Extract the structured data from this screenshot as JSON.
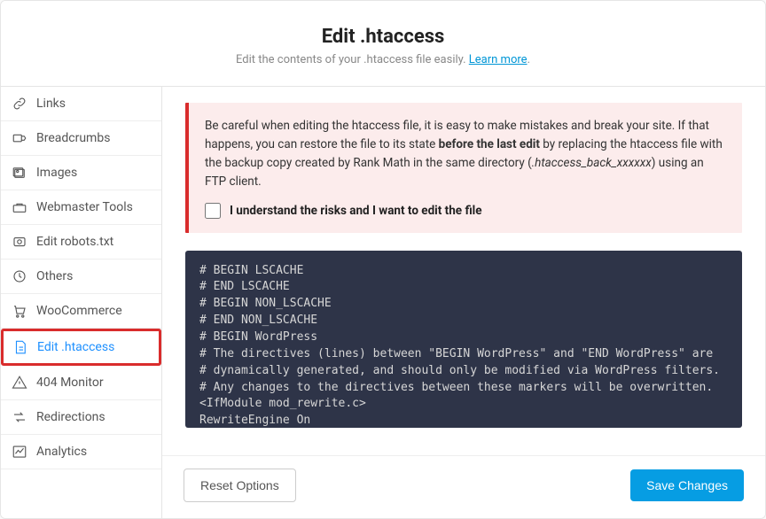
{
  "header": {
    "title": "Edit .htaccess",
    "subtitle_prefix": "Edit the contents of your .htaccess file easily. ",
    "learn_more": "Learn more",
    "subtitle_suffix": "."
  },
  "sidebar": {
    "items": [
      {
        "icon": "link-icon",
        "label": "Links"
      },
      {
        "icon": "breadcrumb-icon",
        "label": "Breadcrumbs"
      },
      {
        "icon": "images-icon",
        "label": "Images"
      },
      {
        "icon": "webmaster-icon",
        "label": "Webmaster Tools"
      },
      {
        "icon": "robots-icon",
        "label": "Edit robots.txt"
      },
      {
        "icon": "others-icon",
        "label": "Others"
      },
      {
        "icon": "cart-icon",
        "label": "WooCommerce"
      },
      {
        "icon": "file-icon",
        "label": "Edit .htaccess"
      },
      {
        "icon": "warning-icon",
        "label": "404 Monitor"
      },
      {
        "icon": "redirections-icon",
        "label": "Redirections"
      },
      {
        "icon": "analytics-icon",
        "label": "Analytics"
      }
    ]
  },
  "main": {
    "warning_pre": "Be careful when editing the htaccess file, it is easy to make mistakes and break your site. If that happens, you can restore the file to its state ",
    "warning_bold": "before the last edit",
    "warning_mid": " by replacing the htaccess file with the backup copy created by Rank Math in the same directory (",
    "warning_italic": ".htaccess_back_xxxxxx",
    "warning_post": ") using an FTP client.",
    "checkbox_label": "I understand the risks and I want to edit the file",
    "code_content": "# BEGIN LSCACHE\n# END LSCACHE\n# BEGIN NON_LSCACHE\n# END NON_LSCACHE\n# BEGIN WordPress\n# The directives (lines) between \"BEGIN WordPress\" and \"END WordPress\" are\n# dynamically generated, and should only be modified via WordPress filters.\n# Any changes to the directives between these markers will be overwritten.\n<IfModule mod_rewrite.c>\nRewriteEngine On\nRewriteBase /"
  },
  "footer": {
    "reset": "Reset Options",
    "save": "Save Changes"
  }
}
